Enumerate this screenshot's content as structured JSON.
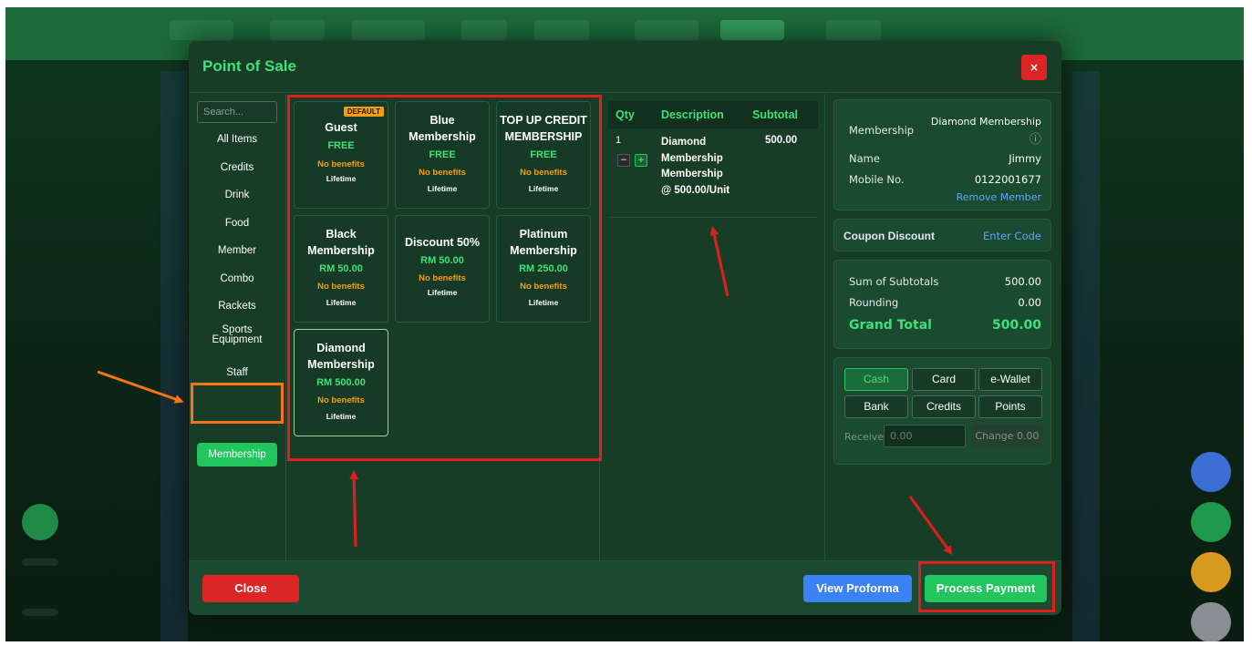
{
  "modal": {
    "title": "Point of Sale",
    "close_symbol": "×"
  },
  "sidebar": {
    "search_placeholder": "Search...",
    "categories": [
      "All Items",
      "Credits",
      "Drink",
      "Food",
      "Member",
      "Combo",
      "Rackets",
      "Sports Equipment",
      "Staff",
      "Membership"
    ],
    "active": "Membership"
  },
  "products": [
    {
      "name": "Guest",
      "price": "FREE",
      "benefits": "No benefits",
      "duration": "Lifetime",
      "badge": "DEFAULT"
    },
    {
      "name": "Blue Membership",
      "price": "FREE",
      "benefits": "No benefits",
      "duration": "Lifetime"
    },
    {
      "name": "TOP UP CREDIT MEMBERSHIP",
      "price": "FREE",
      "benefits": "No benefits",
      "duration": "Lifetime"
    },
    {
      "name": "Black Membership",
      "price": "RM 50.00",
      "benefits": "No benefits",
      "duration": "Lifetime"
    },
    {
      "name": "Discount 50%",
      "price": "RM 50.00",
      "benefits": "No benefits",
      "duration": "Lifetime"
    },
    {
      "name": "Platinum Membership",
      "price": "RM 250.00",
      "benefits": "No benefits",
      "duration": "Lifetime"
    },
    {
      "name": "Diamond Membership",
      "price": "RM 500.00",
      "benefits": "No benefits",
      "duration": "Lifetime"
    }
  ],
  "cart": {
    "headers": {
      "qty": "Qty",
      "description": "Description",
      "subtotal": "Subtotal"
    },
    "items": [
      {
        "qty": "1",
        "description": "Diamond Membership Membership @ 500.00/Unit",
        "subtotal": "500.00"
      }
    ],
    "minus": "−",
    "plus": "+"
  },
  "member": {
    "membership_label": "Membership",
    "membership_value": "Diamond Membership",
    "info_icon": "ⓘ",
    "name_label": "Name",
    "name_value": "Jimmy",
    "mobile_label": "Mobile No.",
    "mobile_value": "0122001677",
    "remove": "Remove Member"
  },
  "coupon": {
    "label": "Coupon Discount",
    "action": "Enter Code"
  },
  "totals": {
    "sum_label": "Sum of Subtotals",
    "sum_value": "500.00",
    "rounding_label": "Rounding",
    "rounding_value": "0.00",
    "grand_label": "Grand Total",
    "grand_value": "500.00"
  },
  "payment": {
    "methods": [
      "Cash",
      "Card",
      "e-Wallet",
      "Bank",
      "Credits",
      "Points"
    ],
    "active": "Cash",
    "receive_label": "Receive",
    "receive_placeholder": "0.00",
    "change_label": "Change 0.00"
  },
  "footer": {
    "close": "Close",
    "proforma": "View Proforma",
    "process": "Process Payment"
  },
  "colors": {
    "accent": "#22c55e",
    "danger": "#dc2626",
    "info": "#3b82f6",
    "warning": "#f59e0b",
    "annotation_red": "#e11d1d",
    "annotation_orange": "#f97316"
  }
}
